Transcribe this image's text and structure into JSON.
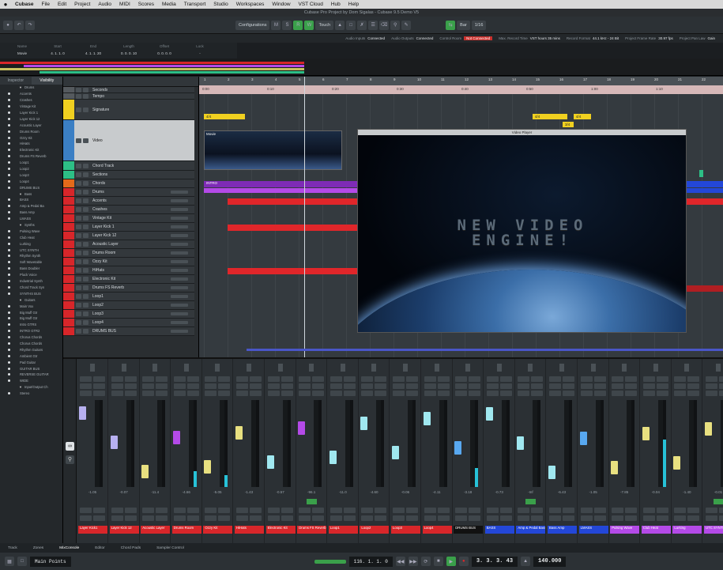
{
  "menubar": {
    "app": "Cubase",
    "items": [
      "File",
      "Edit",
      "Project",
      "Audio",
      "MIDI",
      "Scores",
      "Media",
      "Transport",
      "Studio",
      "Workspaces",
      "Window",
      "VST Cloud",
      "Hub",
      "Help"
    ]
  },
  "window_title": "Cubase Pro Project by Dom Sigalas - Cubase 9.5 Demo V5",
  "toolbar": {
    "configurations": "Configurations",
    "touch": "Touch",
    "grid": "Bar",
    "quantize": "1/16"
  },
  "statusline": [
    {
      "label": "Audio Inputs",
      "value": "Connected"
    },
    {
      "label": "Audio Outputs",
      "value": "Connected"
    },
    {
      "label": "Control Room",
      "value": "Not Connected",
      "alert": true
    },
    {
      "label": "Max. Record Time",
      "value": "VST hours 35 mins"
    },
    {
      "label": "Record Format",
      "value": "44.1 kHz - 24 Bit"
    },
    {
      "label": "Project Frame Rate",
      "value": "30.97 fps"
    },
    {
      "label": "Project Pan Law",
      "value": "Gain"
    }
  ],
  "infoline": [
    {
      "label": "Name",
      "value": "Movie"
    },
    {
      "label": "Start",
      "value": "4. 1. 1. 0"
    },
    {
      "label": "End",
      "value": "4. 1. 1. 20"
    },
    {
      "label": "Length",
      "value": "0. 0. 0. 10"
    },
    {
      "label": "Offset",
      "value": "0. 0. 0. 0"
    },
    {
      "label": "Lock",
      "value": "-"
    }
  ],
  "leftzone": {
    "tabs": [
      "Inspector",
      "Visibility"
    ],
    "rows": [
      {
        "name": "Drums",
        "folder": true
      },
      {
        "name": "Accents"
      },
      {
        "name": "Crashes"
      },
      {
        "name": "Vintage Kit"
      },
      {
        "name": "Layer Kick 1"
      },
      {
        "name": "Layer Kick 12"
      },
      {
        "name": "Acoustic Layer"
      },
      {
        "name": "Drums Room"
      },
      {
        "name": "Ozzy Kit"
      },
      {
        "name": "HiHats"
      },
      {
        "name": "Electronic Kit"
      },
      {
        "name": "Drums FS Reverb"
      },
      {
        "name": "Loop1"
      },
      {
        "name": "Loop2"
      },
      {
        "name": "Loop3"
      },
      {
        "name": "Loop4"
      },
      {
        "name": "DRUMS BUS"
      },
      {
        "name": "Bass",
        "folder": true
      },
      {
        "name": "BASS"
      },
      {
        "name": "Amp & Pedal Ba"
      },
      {
        "name": "Bass Amp"
      },
      {
        "name": "LMASS"
      },
      {
        "name": "Synths",
        "folder": true
      },
      {
        "name": "Pulsing Wave"
      },
      {
        "name": "Club Heat"
      },
      {
        "name": "Lurking"
      },
      {
        "name": "UTC SYNTH"
      },
      {
        "name": "Rhythm Synth"
      },
      {
        "name": "Soft Wavetable"
      },
      {
        "name": "Bass Doubler"
      },
      {
        "name": "Pluck Voice"
      },
      {
        "name": "Industrial Synth"
      },
      {
        "name": "Chord Track Syn"
      },
      {
        "name": "SYNTHS BUS"
      },
      {
        "name": "Guitars",
        "folder": true
      },
      {
        "name": "Main Vox"
      },
      {
        "name": "Big Muff Gtr"
      },
      {
        "name": "Big Muff Gtr"
      },
      {
        "name": "Intro GTRS"
      },
      {
        "name": "INTRO GTR2"
      },
      {
        "name": "Chorus Chords"
      },
      {
        "name": "Chorus Chords"
      },
      {
        "name": "Rhythm Guitars"
      },
      {
        "name": "Ambient Gtr"
      },
      {
        "name": "Pad Guitar"
      },
      {
        "name": "GUITAR BUS"
      },
      {
        "name": "REVERSE GUITAR"
      },
      {
        "name": "WIDE"
      },
      {
        "name": "Input/Output Ch",
        "folder": true
      },
      {
        "name": "Stereo"
      }
    ]
  },
  "tracks": [
    {
      "name": "Seconds",
      "color": "#555a5e"
    },
    {
      "name": "Tempo",
      "color": "#555a5e"
    },
    {
      "name": "Signature",
      "color": "#f0d020"
    },
    {
      "name": "Video",
      "color": "#3b7fc4",
      "video": true
    },
    {
      "name": "Chord Track",
      "color": "#2dbf86"
    },
    {
      "name": "Sections",
      "color": "#2dbf86"
    },
    {
      "name": "Chords",
      "color": "#e46a1a"
    },
    {
      "name": "Drums",
      "color": "#d8262a"
    },
    {
      "name": "Accents",
      "color": "#d8262a"
    },
    {
      "name": "Crashes",
      "color": "#d8262a"
    },
    {
      "name": "Vintage Kit",
      "color": "#d8262a"
    },
    {
      "name": "Layer Kick 1",
      "color": "#d8262a"
    },
    {
      "name": "Layer Kick 12",
      "color": "#d8262a"
    },
    {
      "name": "Acoustic Layer",
      "color": "#d8262a"
    },
    {
      "name": "Drums Room",
      "color": "#d8262a"
    },
    {
      "name": "Ozzy Kit",
      "color": "#d8262a"
    },
    {
      "name": "HiHats",
      "color": "#d8262a"
    },
    {
      "name": "Electronic Kit",
      "color": "#d8262a"
    },
    {
      "name": "Drums FS Reverb",
      "color": "#d8262a"
    },
    {
      "name": "Loop1",
      "color": "#d8262a"
    },
    {
      "name": "Loop2",
      "color": "#d8262a"
    },
    {
      "name": "Loop3",
      "color": "#d8262a"
    },
    {
      "name": "Loop4",
      "color": "#d8262a"
    },
    {
      "name": "DRUMS BUS",
      "color": "#d8262a"
    }
  ],
  "ruler_top": [
    "1",
    "2",
    "3",
    "4",
    "5",
    "6",
    "7",
    "8",
    "9",
    "10",
    "11",
    "12",
    "13",
    "14",
    "15",
    "16",
    "17",
    "18",
    "19",
    "20",
    "21",
    "22"
  ],
  "ruler_bottom": [
    "0:00",
    "0:10",
    "0:20",
    "0:30",
    "0:40",
    "0:50",
    "1:00",
    "1:10"
  ],
  "project": {
    "signatures": [
      "4/4",
      "4/4",
      "4/4",
      "3/4"
    ],
    "movie_clip": "Movie",
    "intro_clip": "INTRO"
  },
  "video_player": {
    "title": "Video Player",
    "overlay_line1": "NEW VIDEO",
    "overlay_line2": "ENGINE!"
  },
  "mixer": {
    "channels": [
      {
        "label": "Layer Kick1",
        "color": "#d8262a",
        "cap": "#b7b0f0",
        "meter": 0,
        "db": "-1.05"
      },
      {
        "label": "Layer Kick 12",
        "color": "#d8262a",
        "cap": "#b7b0f0",
        "meter": 0,
        "db": "-0.07"
      },
      {
        "label": "Acoustic Layer",
        "color": "#d8262a",
        "cap": "#e8e080",
        "meter": 0,
        "db": "-11.4"
      },
      {
        "label": "Drums Room",
        "color": "#d8262a",
        "cap": "#b44ae8",
        "meter": 0.18,
        "db": "-4.66"
      },
      {
        "label": "Ozzy Kit",
        "color": "#d8262a",
        "cap": "#e8e080",
        "meter": 0.14,
        "db": "-5.05"
      },
      {
        "label": "HiHats",
        "color": "#d8262a",
        "cap": "#e8e080",
        "meter": 0,
        "db": "-1.43"
      },
      {
        "label": "Electronic Kit",
        "color": "#d8262a",
        "cap": "#a0e8f0",
        "meter": 0,
        "db": "-0.57"
      },
      {
        "label": "Drums FS Reverb",
        "color": "#d8262a",
        "cap": "#b44ae8",
        "meter": 0,
        "db": "-96.1",
        "green": true
      },
      {
        "label": "Loop1",
        "color": "#d8262a",
        "cap": "#a0e8f0",
        "meter": 0,
        "db": "-11.0"
      },
      {
        "label": "Loop2",
        "color": "#d8262a",
        "cap": "#a0e8f0",
        "meter": 0,
        "db": "-4.60"
      },
      {
        "label": "Loop3",
        "color": "#d8262a",
        "cap": "#a0e8f0",
        "meter": 0,
        "db": "-0.06"
      },
      {
        "label": "Loop4",
        "color": "#d8262a",
        "cap": "#a0e8f0",
        "meter": 0,
        "db": "-4.11"
      },
      {
        "label": "DRUMS BUS",
        "color": "#111111",
        "cap": "#58a8f0",
        "meter": 0.22,
        "db": "-3.18"
      },
      {
        "label": "BASS",
        "color": "#2347d8",
        "cap": "#a0e8f0",
        "meter": 0,
        "db": "-0.73"
      },
      {
        "label": "Amp & Pedal Bass",
        "color": "#2347d8",
        "cap": "#a0e8f0",
        "meter": 0,
        "db": "-Inf",
        "green": true
      },
      {
        "label": "Bass Amp",
        "color": "#2347d8",
        "cap": "#a0e8f0",
        "meter": 0,
        "db": "-6.43"
      },
      {
        "label": "LMASS",
        "color": "#2347d8",
        "cap": "#58a8f0",
        "meter": 0,
        "db": "-1.05"
      },
      {
        "label": "Pulsing Wave",
        "color": "#b44ae8",
        "cap": "#e8e080",
        "meter": 0,
        "db": "-7.85"
      },
      {
        "label": "Club Heat",
        "color": "#b44ae8",
        "cap": "#e8e080",
        "meter": 0.55,
        "db": "-0.04"
      },
      {
        "label": "Lurking",
        "color": "#b44ae8",
        "cap": "#e8e080",
        "meter": 0,
        "db": "-1.40"
      },
      {
        "label": "UTC SYNTH",
        "color": "#b44ae8",
        "cap": "#e8e080",
        "meter": 0,
        "db": "-0.01",
        "green": true
      }
    ]
  },
  "bottom_tabs": [
    "Track",
    "Zones",
    "MixConsole",
    "Editor",
    "Chord Pads",
    "Sampler Control"
  ],
  "transport": {
    "position_left": "116. 1. 1. 0",
    "position_main": "3. 3. 3. 43",
    "tempo": "140.000",
    "mode": "Main Points"
  }
}
